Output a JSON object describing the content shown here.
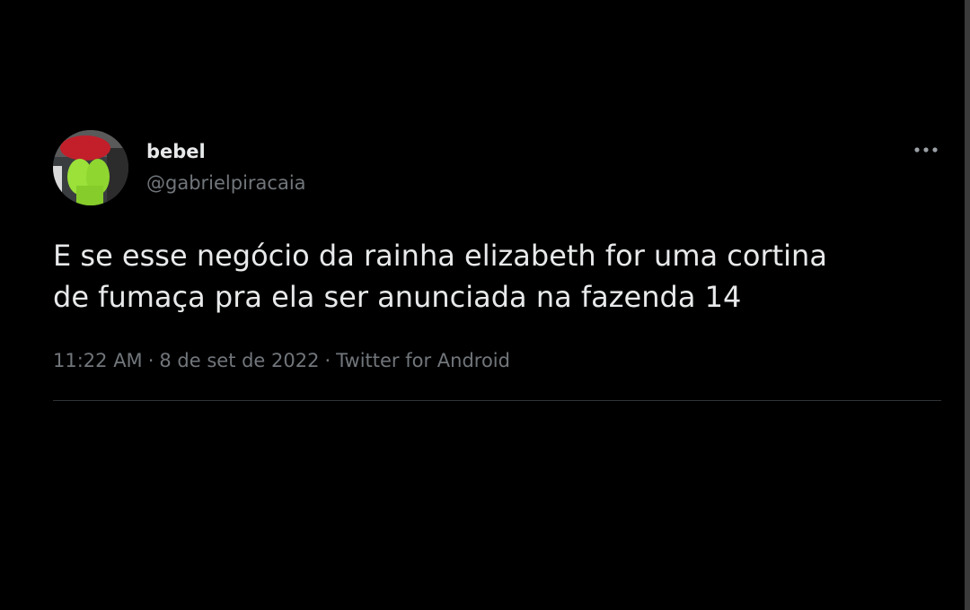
{
  "author": {
    "display_name": "bebel",
    "handle": "@gabrielpiracaia",
    "avatar_icon": "avatar-photo"
  },
  "tweet": {
    "text": "E se esse negócio da rainha elizabeth for uma cortina\nde fumaça pra ela ser anunciada na fazenda 14",
    "time": "11:22 AM",
    "separator": "·",
    "date": "8 de set de 2022",
    "source": "Twitter for Android"
  },
  "actions": {
    "more_icon": "more-horizontal-icon"
  },
  "colors": {
    "background": "#000000",
    "primary_text": "#e7e9ea",
    "secondary_text": "#71767b",
    "divider": "#2f3336"
  }
}
